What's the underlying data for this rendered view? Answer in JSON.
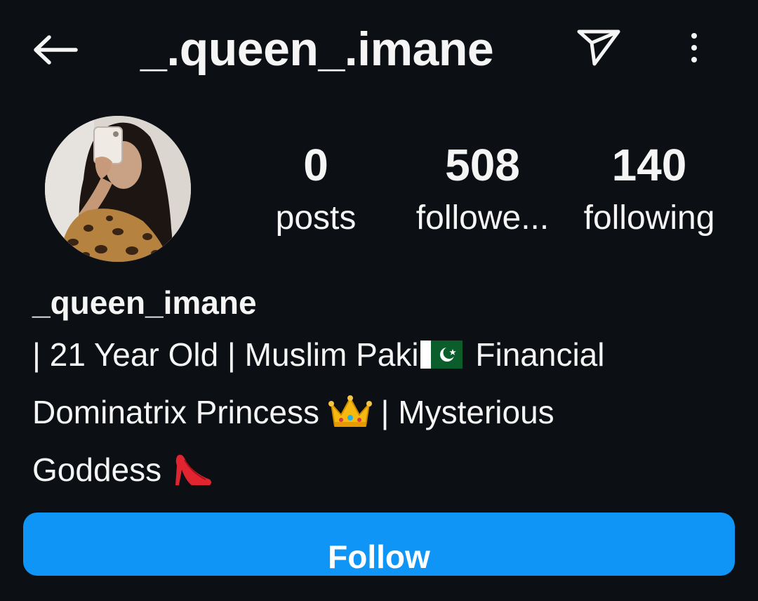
{
  "header": {
    "username": "_.queen_.imane",
    "back_icon": "arrow-left-icon",
    "share_icon": "paper-plane-icon",
    "more_icon": "more-vertical-icon"
  },
  "profile": {
    "stats": {
      "posts_count": "0",
      "posts_label": "posts",
      "followers_count": "508",
      "followers_label": "followe...",
      "following_count": "140",
      "following_label": "following"
    },
    "display_name": "_queen_imane",
    "bio": {
      "line1_prefix": "| 21 Year Old | Muslim Paki",
      "line1_suffix": " Financial",
      "line2_prefix": "Dominatrix Princess ",
      "line2_suffix": " | Mysterious",
      "line3": "Goddess "
    },
    "emoji": {
      "flag": "pakistan-flag-icon",
      "crown": "crown-icon",
      "heel": "high-heel-icon"
    }
  },
  "actions": {
    "follow_label": "Follow"
  },
  "colors": {
    "background": "#0c0f14",
    "text": "#f5f5f5",
    "follow_button": "#0f95f6"
  }
}
